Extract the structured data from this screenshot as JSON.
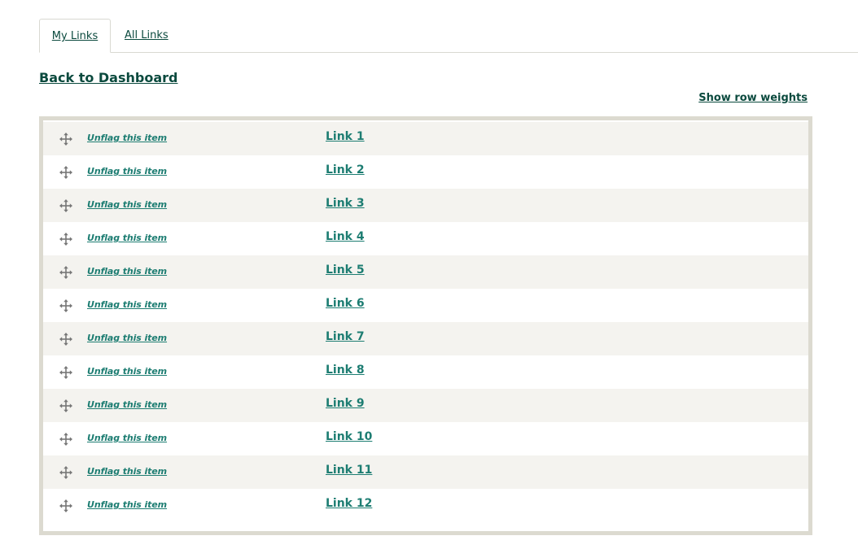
{
  "tabs": [
    {
      "label": "My Links",
      "active": true
    },
    {
      "label": "All Links",
      "active": false
    }
  ],
  "back_link": "Back to Dashboard",
  "show_row_weights": "Show row weights",
  "rows": [
    {
      "action": "Unflag this item",
      "title": "Link 1"
    },
    {
      "action": "Unflag this item",
      "title": "Link 2"
    },
    {
      "action": "Unflag this item",
      "title": "Link 3"
    },
    {
      "action": "Unflag this item",
      "title": "Link 4"
    },
    {
      "action": "Unflag this item",
      "title": "Link 5"
    },
    {
      "action": "Unflag this item",
      "title": "Link 6"
    },
    {
      "action": "Unflag this item",
      "title": "Link 7"
    },
    {
      "action": "Unflag this item",
      "title": "Link 8"
    },
    {
      "action": "Unflag this item",
      "title": "Link 9"
    },
    {
      "action": "Unflag this item",
      "title": "Link 10"
    },
    {
      "action": "Unflag this item",
      "title": "Link 11"
    },
    {
      "action": "Unflag this item",
      "title": "Link 12"
    }
  ],
  "icons": {
    "row_handle": "drag-handle-icon"
  },
  "colors": {
    "link": "#0b4a3e",
    "row_link": "#1d7d72",
    "row_alt": "#f4f3ef",
    "table_border": "#dcdad0"
  }
}
